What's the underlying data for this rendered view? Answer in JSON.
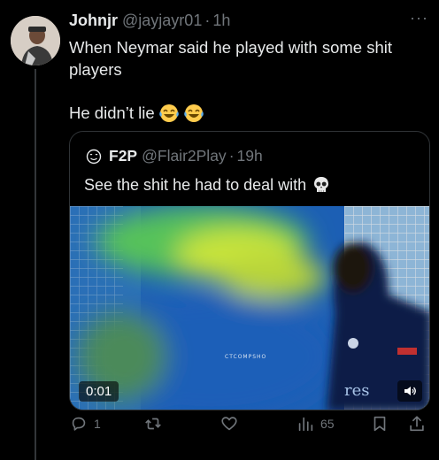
{
  "tweet": {
    "author_name": "Johnjr",
    "author_handle": "@jayjayr01",
    "separator": "·",
    "time": "1h",
    "more_icon": "more-horizontal-icon",
    "text_line1": "When Neymar said he played with some shit players",
    "text_line2": "He didn’t lie",
    "emojis": [
      "laughing-crying-emoji",
      "laughing-crying-emoji"
    ]
  },
  "quoted": {
    "icon": "face-savoring-icon",
    "author_name": "F2P",
    "author_handle": "@Flair2Play",
    "separator": "·",
    "time": "19h",
    "text": "See the shit he had to deal with",
    "emoji": "skull-emoji",
    "video": {
      "watermark": "CTCOMPSHO",
      "elapsed": "0:01",
      "overlay_text": "res",
      "volume_icon": "volume-icon"
    }
  },
  "actions": {
    "reply_count": "1",
    "retweet_count": "",
    "like_count": "",
    "views_count": "65"
  },
  "colors": {
    "background": "#000000",
    "text": "#e7e9ea",
    "secondary": "#71767b",
    "border": "#2f3336"
  }
}
